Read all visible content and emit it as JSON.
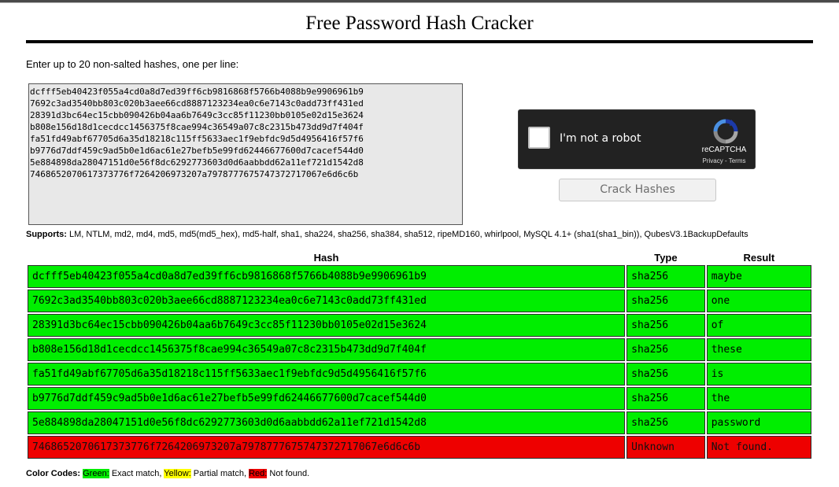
{
  "page": {
    "title": "Free Password Hash Cracker"
  },
  "form": {
    "instructions": "Enter up to 20 non-salted hashes, one per line:",
    "textarea_value": "dcfff5eb40423f055a4cd0a8d7ed39ff6cb9816868f5766b4088b9e9906961b9\n7692c3ad3540bb803c020b3aee66cd8887123234ea0c6e7143c0add73ff431ed\n28391d3bc64ec15cbb090426b04aa6b7649c3cc85f11230bb0105e02d15e3624\nb808e156d18d1cecdcc1456375f8cae994c36549a07c8c2315b473dd9d7f404f\nfa51fd49abf67705d6a35d18218c115ff5633aec1f9ebfdc9d5d4956416f57f6\nb9776d7ddf459c9ad5b0e1d6ac61e27befb5e99fd62446677600d7cacef544d0\n5e884898da28047151d0e56f8dc6292773603d0d6aabbdd62a11ef721d1542d8\n7468652070617373776f7264206973207a7978777675747372717067e6d6c6b",
    "crack_button": "Crack Hashes"
  },
  "captcha": {
    "label": "I'm not a robot",
    "brand": "reCAPTCHA",
    "links": "Privacy - Terms",
    "icon": "recaptcha-logo-icon"
  },
  "supports": {
    "label": "Supports:",
    "text": "LM, NTLM, md2, md4, md5, md5(md5_hex), md5-half, sha1, sha224, sha256, sha384, sha512, ripeMD160, whirlpool, MySQL 4.1+ (sha1(sha1_bin)), QubesV3.1BackupDefaults"
  },
  "results": {
    "headers": [
      "Hash",
      "Type",
      "Result"
    ],
    "rows": [
      {
        "hash": "dcfff5eb40423f055a4cd0a8d7ed39ff6cb9816868f5766b4088b9e9906961b9",
        "type": "sha256",
        "result": "maybe",
        "status": "green"
      },
      {
        "hash": "7692c3ad3540bb803c020b3aee66cd8887123234ea0c6e7143c0add73ff431ed",
        "type": "sha256",
        "result": "one",
        "status": "green"
      },
      {
        "hash": "28391d3bc64ec15cbb090426b04aa6b7649c3cc85f11230bb0105e02d15e3624",
        "type": "sha256",
        "result": "of",
        "status": "green"
      },
      {
        "hash": "b808e156d18d1cecdcc1456375f8cae994c36549a07c8c2315b473dd9d7f404f",
        "type": "sha256",
        "result": "these",
        "status": "green"
      },
      {
        "hash": "fa51fd49abf67705d6a35d18218c115ff5633aec1f9ebfdc9d5d4956416f57f6",
        "type": "sha256",
        "result": "is",
        "status": "green"
      },
      {
        "hash": "b9776d7ddf459c9ad5b0e1d6ac61e27befb5e99fd62446677600d7cacef544d0",
        "type": "sha256",
        "result": "the",
        "status": "green"
      },
      {
        "hash": "5e884898da28047151d0e56f8dc6292773603d0d6aabbdd62a11ef721d1542d8",
        "type": "sha256",
        "result": "password",
        "status": "green"
      },
      {
        "hash": "7468652070617373776f7264206973207a7978777675747372717067e6d6c6b",
        "type": "Unknown",
        "result": "Not found.",
        "status": "red"
      }
    ]
  },
  "color_codes": {
    "label": "Color Codes:",
    "green": "Green:",
    "green_desc": "Exact match,",
    "yellow": "Yellow:",
    "yellow_desc": "Partial match,",
    "red": "Red:",
    "red_desc": "Not found."
  },
  "colors": {
    "green": "#00ee00",
    "red": "#ee0000",
    "yellow": "#ffff00"
  }
}
